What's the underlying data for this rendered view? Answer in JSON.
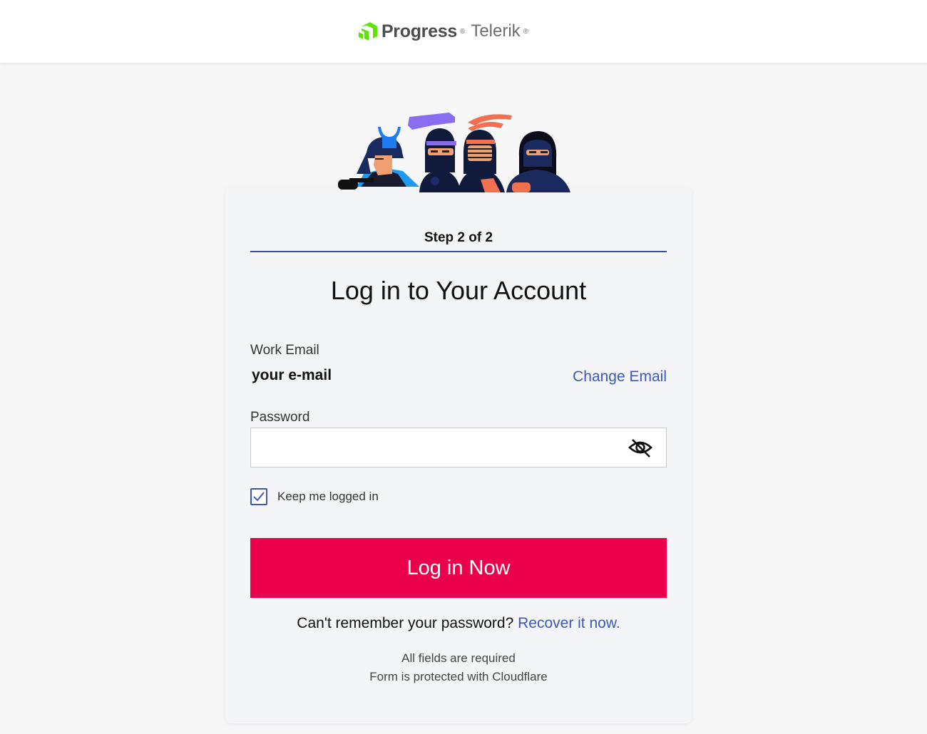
{
  "header": {
    "logo_brand": "Progress",
    "logo_product": "Telerik"
  },
  "card": {
    "step": "Step 2 of 2",
    "title": "Log in to Your Account",
    "email_label": "Work Email",
    "email_value": "your e-mail",
    "change_email": "Change Email",
    "password_label": "Password",
    "password_value": "",
    "keep_logged_in_label": "Keep me logged in",
    "keep_logged_in_checked": true,
    "login_button": "Log in Now",
    "recover_prompt": "Can't remember your password?",
    "recover_link": "Recover it now.",
    "note_required": "All fields are required",
    "note_cloudflare": "Form is protected with Cloudflare"
  },
  "icons": {
    "logo": "progress-logo-icon",
    "eye": "eye-slash-icon",
    "check": "checkmark-icon",
    "illustration": "ninjas-illustration"
  },
  "colors": {
    "accent": "#ea004b",
    "link": "#3d58b5",
    "step_line": "#3d4e9a",
    "logo_green": "#5ce500"
  }
}
